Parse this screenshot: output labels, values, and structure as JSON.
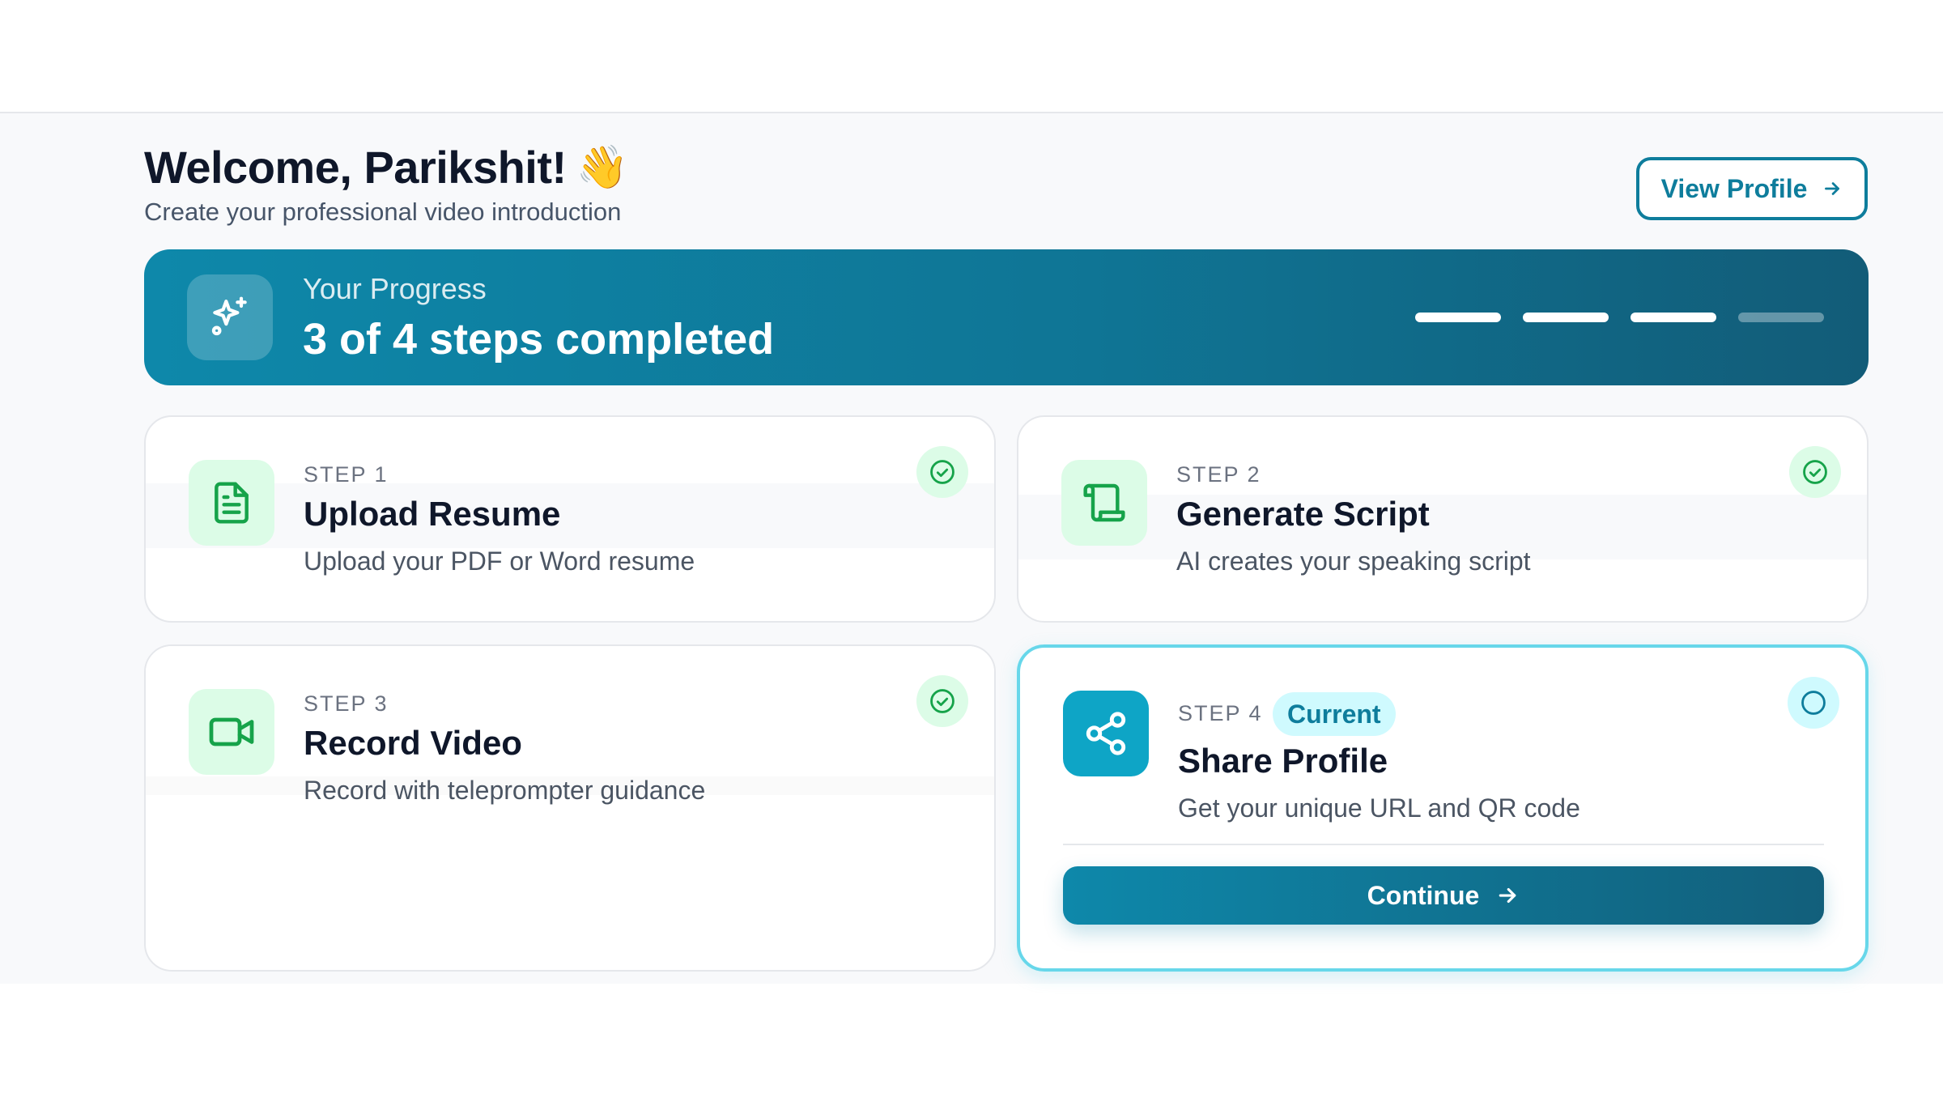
{
  "header": {
    "welcome": "Welcome, Parikshit!",
    "wave_emoji": "👋",
    "subtitle": "Create your professional video introduction",
    "view_profile_label": "View Profile",
    "view_profile_icon": "arrow-right-icon"
  },
  "progress": {
    "label": "Your Progress",
    "value": "3 of 4 steps completed",
    "completed": 3,
    "total": 4,
    "icon": "sparkles-icon"
  },
  "steps": [
    {
      "label": "STEP 1",
      "title": "Upload Resume",
      "description": "Upload your PDF or Word resume",
      "status": "completed",
      "icon": "file-text-icon"
    },
    {
      "label": "STEP 2",
      "title": "Generate Script",
      "description": "AI creates your speaking script",
      "status": "completed",
      "icon": "scroll-icon"
    },
    {
      "label": "STEP 3",
      "title": "Record Video",
      "description": "Record with teleprompter guidance",
      "status": "completed",
      "icon": "video-icon"
    },
    {
      "label": "STEP 4",
      "title": "Share Profile",
      "description": "Get your unique URL and QR code",
      "status": "current",
      "badge": "Current",
      "icon": "share-icon",
      "button_label": "Continue"
    }
  ],
  "colors": {
    "accent": "#0e7d9c",
    "progress_start": "#0e88aa",
    "progress_end": "#125c78",
    "success": "#16a34a",
    "success_bg": "#dcfce7",
    "current_border": "#67d7ea",
    "current_bg": "#cffafe"
  }
}
